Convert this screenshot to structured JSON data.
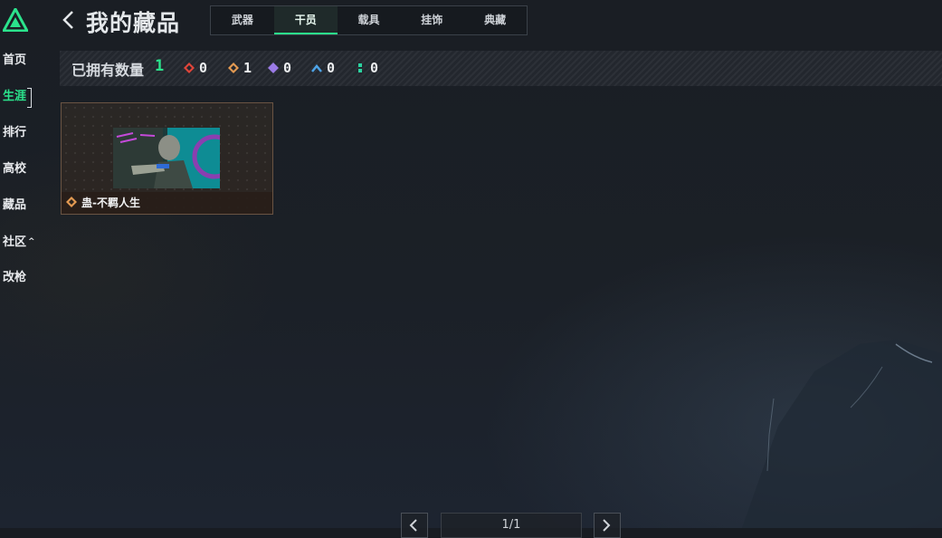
{
  "sidebar": {
    "items": [
      {
        "label": "首页"
      },
      {
        "label": "生涯"
      },
      {
        "label": "排行"
      },
      {
        "label": "高校"
      },
      {
        "label": "藏品"
      },
      {
        "label": "社区",
        "caret": "^"
      },
      {
        "label": "改枪"
      }
    ],
    "active_index": 1
  },
  "header": {
    "title": "我的藏品",
    "tabs": [
      {
        "label": "武器"
      },
      {
        "label": "干员"
      },
      {
        "label": "载具"
      },
      {
        "label": "挂饰"
      },
      {
        "label": "典藏"
      }
    ],
    "active_tab_index": 1
  },
  "summary": {
    "owned_label": "已拥有数量",
    "owned_total": "1",
    "rarity_counts": [
      {
        "icon": "red-diamond-icon",
        "color": "#e0453a",
        "count": "0"
      },
      {
        "icon": "orange-diamond-icon",
        "color": "#e39a52",
        "count": "1"
      },
      {
        "icon": "purple-diamond-icon",
        "color": "#9b7be6",
        "count": "0"
      },
      {
        "icon": "blue-chevron-icon",
        "color": "#4da3e6",
        "count": "0"
      },
      {
        "icon": "green-dots-icon",
        "color": "#2bd3a0",
        "count": "0"
      }
    ]
  },
  "items": [
    {
      "name": "蛊-不羁人生",
      "rarity_icon": "orange-diamond-icon",
      "rarity_color": "#e39a52"
    }
  ],
  "pagination": {
    "text": "1/1"
  },
  "colors": {
    "accent": "#2be38c",
    "background": "#181c22"
  }
}
